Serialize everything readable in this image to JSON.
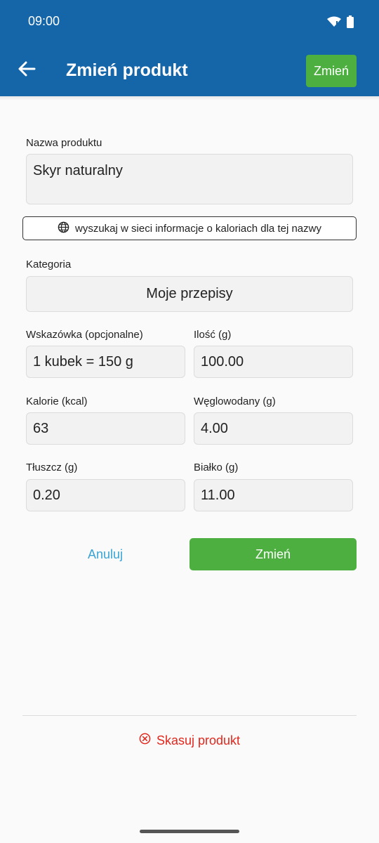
{
  "status_bar": {
    "time": "09:00",
    "icons": [
      "wifi-icon",
      "battery-icon"
    ]
  },
  "header": {
    "title": "Zmień produkt",
    "action_label": "Zmień"
  },
  "form": {
    "name": {
      "label": "Nazwa produktu",
      "value": "Skyr naturalny"
    },
    "search_web_label": "wyszukaj w sieci informacje o kaloriach dla tej nazwy",
    "category": {
      "label": "Kategoria",
      "value": "Moje przepisy"
    },
    "hint": {
      "label": "Wskazówka (opcjonalne)",
      "value": "1 kubek = 150 g"
    },
    "amount": {
      "label": "Ilość (g)",
      "value": "100.00"
    },
    "calories": {
      "label": "Kalorie (kcal)",
      "value": "63"
    },
    "carbs": {
      "label": "Węglowodany (g)",
      "value": "4.00"
    },
    "fat": {
      "label": "Tłuszcz (g)",
      "value": "0.20"
    },
    "protein": {
      "label": "Białko (g)",
      "value": "11.00"
    }
  },
  "actions": {
    "cancel_label": "Anuluj",
    "confirm_label": "Zmień"
  },
  "delete_label": "Skasuj produkt",
  "colors": {
    "appbar": "#1565a9",
    "accent_green": "#4caf3f",
    "link_blue": "#3aa3d4",
    "danger_red": "#e0281e"
  }
}
